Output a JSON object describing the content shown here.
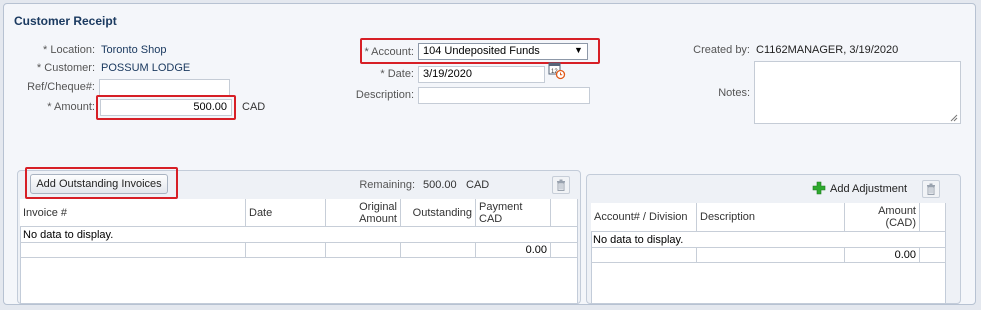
{
  "form": {
    "title": "Customer Receipt",
    "location": {
      "label": "* Location:",
      "value": "Toronto Shop"
    },
    "customer": {
      "label": "* Customer:",
      "value": "POSSUM LODGE"
    },
    "ref": {
      "label": "Ref/Cheque#:",
      "value": ""
    },
    "amount": {
      "label": "* Amount:",
      "value": "500.00",
      "currency": "CAD"
    },
    "account": {
      "label": "* Account:",
      "value": "104 Undeposited Funds"
    },
    "date": {
      "label": "* Date:",
      "value": "3/19/2020"
    },
    "description": {
      "label": "Description:",
      "value": ""
    },
    "created_by": {
      "label": "Created by:",
      "value": "C1162MANAGER, 3/19/2020"
    },
    "notes": {
      "label": "Notes:",
      "value": ""
    }
  },
  "invoices": {
    "add_button": "Add Outstanding Invoices",
    "remaining_label": "Remaining:",
    "remaining_value": "500.00",
    "remaining_currency": "CAD",
    "columns": [
      "Invoice #",
      "Date",
      "Original Amount",
      "Outstanding",
      "Payment CAD"
    ],
    "empty_text": "No data to display.",
    "total": "0.00"
  },
  "adjustments": {
    "add_button": "Add Adjustment",
    "columns": [
      "Account# / Division",
      "Description",
      "Amount (CAD)"
    ],
    "empty_text": "No data to display.",
    "total": "0.00"
  },
  "colors": {
    "highlight": "#d71f26",
    "accent": "#1b3a60",
    "add_icon": "#2ea92e"
  }
}
